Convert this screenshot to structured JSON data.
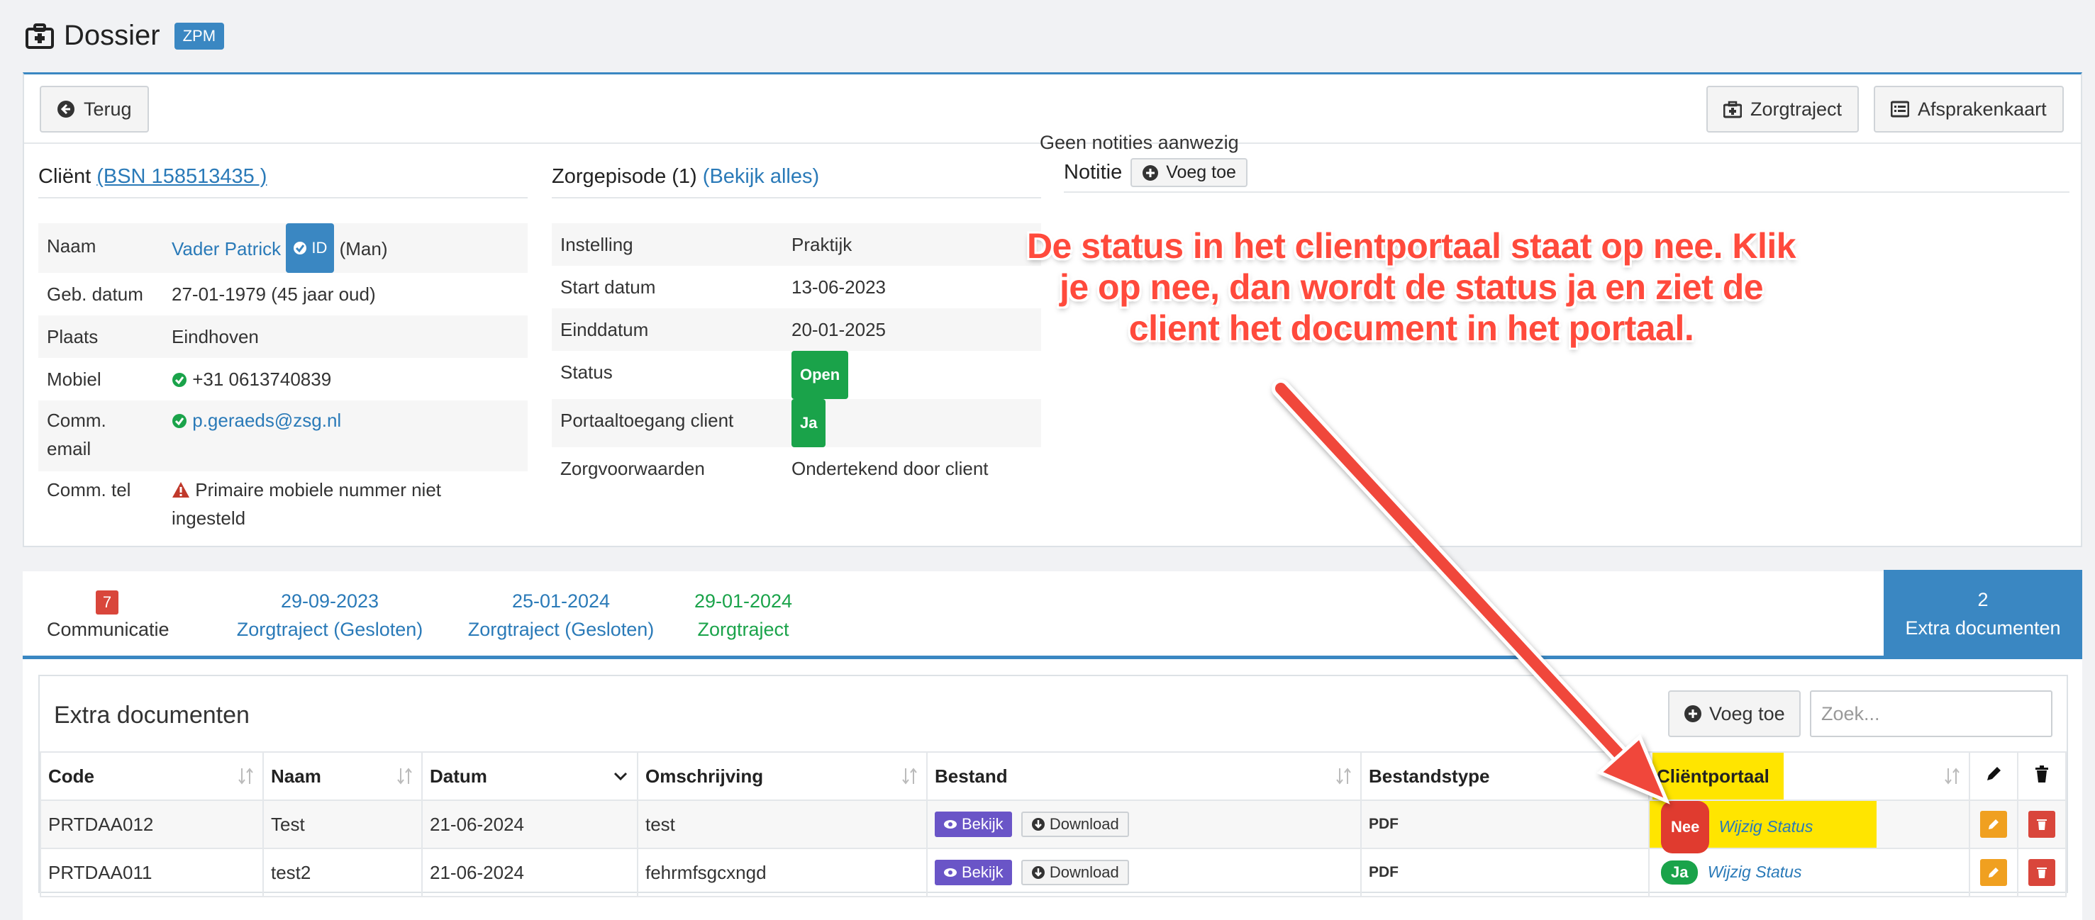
{
  "header": {
    "title": "Dossier",
    "badge": "ZPM"
  },
  "toolbar": {
    "back_label": "Terug",
    "zorgtraject_label": "Zorgtraject",
    "afsprakenkaart_label": "Afsprakenkaart"
  },
  "client": {
    "section_label": "Cliënt",
    "bsn_link": "(BSN 158513435 )",
    "rows": {
      "naam_label": "Naam",
      "naam_value": "Vader Patrick",
      "id_badge": "ID",
      "gender": "(Man)",
      "geb_label": "Geb. datum",
      "geb_value": "27-01-1979 (45 jaar oud)",
      "plaats_label": "Plaats",
      "plaats_value": "Eindhoven",
      "mobiel_label": "Mobiel",
      "mobiel_value": "+31 0613740839",
      "email_label": "Comm. email",
      "email_value": "p.geraeds@zsg.nl",
      "tel_label": "Comm. tel",
      "tel_value": "Primaire mobiele nummer niet ingesteld"
    }
  },
  "zorgepisode": {
    "section_label": "Zorgepisode (1)",
    "link": "(Bekijk alles)",
    "rows": {
      "instelling_label": "Instelling",
      "instelling_value": "Praktijk",
      "start_label": "Start datum",
      "start_value": "13-06-2023",
      "eind_label": "Einddatum",
      "eind_value": "20-01-2025",
      "status_label": "Status",
      "status_value": "Open",
      "portaal_label": "Portaaltoegang client",
      "portaal_value": "Ja",
      "voorw_label": "Zorgvoorwaarden",
      "voorw_value": "Ondertekend door client"
    }
  },
  "notitie": {
    "section_label": "Notitie",
    "add_label": "Voeg toe",
    "empty_text": "Geen notities aanwezig"
  },
  "annotation": {
    "text": "De status in het clientportaal staat op nee. Klik je op nee, dan wordt de status ja en ziet de client het document in het portaal.",
    "color": "#ff4a3c"
  },
  "tabs": {
    "comm_count": "7",
    "comm_label": "Communicatie",
    "z1_date": "29-09-2023",
    "z1_label": "Zorgtraject (Gesloten)",
    "z2_date": "25-01-2024",
    "z2_label": "Zorgtraject (Gesloten)",
    "z3_date": "29-01-2024",
    "z3_label": "Zorgtraject",
    "active_count": "2",
    "active_label": "Extra documenten"
  },
  "docs": {
    "title": "Extra documenten",
    "add_label": "Voeg toe",
    "search_placeholder": "Zoek...",
    "columns": {
      "code": "Code",
      "naam": "Naam",
      "datum": "Datum",
      "omschrijving": "Omschrijving",
      "bestand": "Bestand",
      "bestandstype": "Bestandstype",
      "clientportaal": "Cliëntportaal"
    },
    "bekijk_label": "Bekijk",
    "download_label": "Download",
    "wijzig_label": "Wijzig Status",
    "rows": [
      {
        "code": "PRTDAA012",
        "naam": "Test",
        "datum": "21-06-2024",
        "omschrijving": "test",
        "type": "PDF",
        "portaal": "Nee"
      },
      {
        "code": "PRTDAA011",
        "naam": "test2",
        "datum": "21-06-2024",
        "omschrijving": "fehrmfsgcxngd",
        "type": "PDF",
        "portaal": "Ja"
      }
    ]
  },
  "colors": {
    "primary": "#3a87c2",
    "success": "#1aa34a",
    "danger": "#d9463b",
    "highlight": "#ffe500"
  }
}
